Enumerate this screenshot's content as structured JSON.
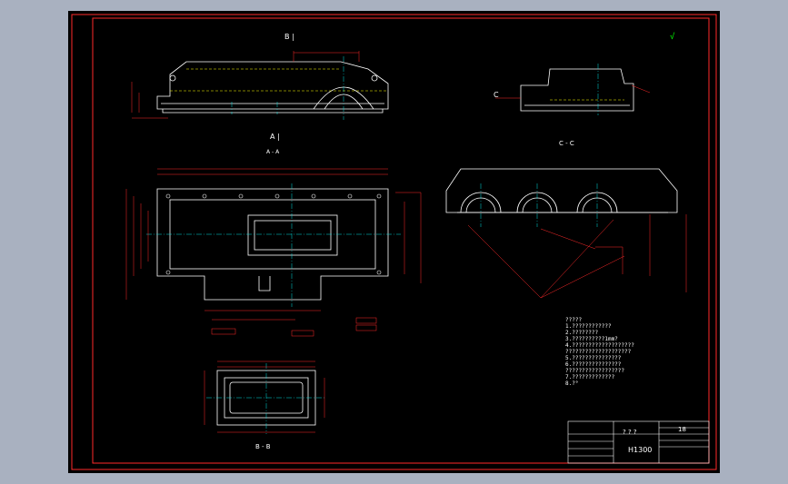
{
  "window": {
    "background": "#a9b1c0",
    "canvas": "#000000"
  },
  "colors": {
    "frame": "#ff2a2a",
    "outline": "#ffffff",
    "dimension": "#ff2a2a",
    "annotation": "#00ff00",
    "centerline": "#00e0e0",
    "hidden": "#ffff00"
  },
  "views": {
    "top_label": "B |",
    "a_label": "A |",
    "a_section": "A - A",
    "c_label": "C",
    "c_section": "C - C",
    "b_section": "B - B"
  },
  "roughness": "√",
  "notes": [
    "?????",
    "1.????????????",
    "2.????????",
    "3.??????????1mm?",
    "4.???????????????????",
    "????????????????????",
    "5.???????????????",
    "6.???????????????",
    "??????????????????",
    "7.?????????????",
    "8.?°"
  ],
  "title_block": {
    "title": "? ? ?",
    "sheet_count": "18",
    "part_no": "H1300"
  }
}
